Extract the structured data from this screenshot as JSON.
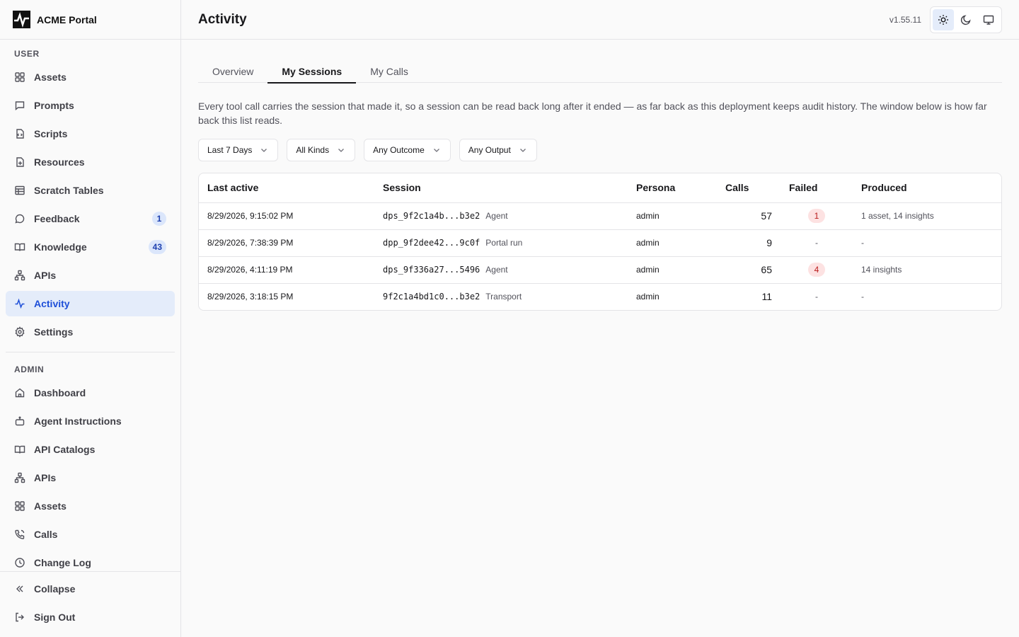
{
  "brand": {
    "name": "ACME Portal"
  },
  "sidebar": {
    "user_label": "USER",
    "user_items": [
      {
        "label": "Assets",
        "icon": "grid-icon"
      },
      {
        "label": "Prompts",
        "icon": "message-icon"
      },
      {
        "label": "Scripts",
        "icon": "script-icon"
      },
      {
        "label": "Resources",
        "icon": "file-plus-icon"
      },
      {
        "label": "Scratch Tables",
        "icon": "table-icon"
      },
      {
        "label": "Feedback",
        "icon": "chat-bubble-icon",
        "badge": "1"
      },
      {
        "label": "Knowledge",
        "icon": "book-open-icon",
        "badge": "43"
      },
      {
        "label": "APIs",
        "icon": "network-icon"
      },
      {
        "label": "Activity",
        "icon": "activity-icon",
        "active": true
      },
      {
        "label": "Settings",
        "icon": "gear-icon"
      }
    ],
    "admin_label": "ADMIN",
    "admin_items": [
      {
        "label": "Dashboard",
        "icon": "home-icon"
      },
      {
        "label": "Agent Instructions",
        "icon": "bot-icon"
      },
      {
        "label": "API Catalogs",
        "icon": "book-open-icon"
      },
      {
        "label": "APIs",
        "icon": "network-icon"
      },
      {
        "label": "Assets",
        "icon": "grid-icon"
      },
      {
        "label": "Calls",
        "icon": "phone-icon"
      },
      {
        "label": "Change Log",
        "icon": "clock-icon"
      }
    ],
    "collapse_label": "Collapse",
    "signout_label": "Sign Out"
  },
  "header": {
    "title": "Activity",
    "version": "v1.55.11",
    "theme_active": "light"
  },
  "tabs": [
    {
      "label": "Overview",
      "active": false
    },
    {
      "label": "My Sessions",
      "active": true
    },
    {
      "label": "My Calls",
      "active": false
    }
  ],
  "description": "Every tool call carries the session that made it, so a session can be read back long after it ended — as far back as this deployment keeps audit history. The window below is how far back this list reads.",
  "filters": [
    {
      "label": "Last 7 Days"
    },
    {
      "label": "All Kinds"
    },
    {
      "label": "Any Outcome"
    },
    {
      "label": "Any Output"
    }
  ],
  "table": {
    "columns": [
      "Last active",
      "Session",
      "Persona",
      "Calls",
      "Failed",
      "Produced"
    ],
    "rows": [
      {
        "last_active": "8/29/2026, 9:15:02 PM",
        "session": "dps_9f2c1a4b...b3e2",
        "kind": "Agent",
        "persona": "admin",
        "calls": "57",
        "failed": "1",
        "produced": "1 asset, 14 insights"
      },
      {
        "last_active": "8/29/2026, 7:38:39 PM",
        "session": "dpp_9f2dee42...9c0f",
        "kind": "Portal run",
        "persona": "admin",
        "calls": "9",
        "failed": "-",
        "produced": "-"
      },
      {
        "last_active": "8/29/2026, 4:11:19 PM",
        "session": "dps_9f336a27...5496",
        "kind": "Agent",
        "persona": "admin",
        "calls": "65",
        "failed": "4",
        "produced": "14 insights"
      },
      {
        "last_active": "8/29/2026, 3:18:15 PM",
        "session": "9f2c1a4bd1c0...b3e2",
        "kind": "Transport",
        "persona": "admin",
        "calls": "11",
        "failed": "-",
        "produced": "-"
      }
    ]
  },
  "colors": {
    "accent": "#1d4ed8",
    "active_bg": "#e4ecfa",
    "fail_bg": "#fde2e2",
    "fail_text": "#b91c1c"
  }
}
